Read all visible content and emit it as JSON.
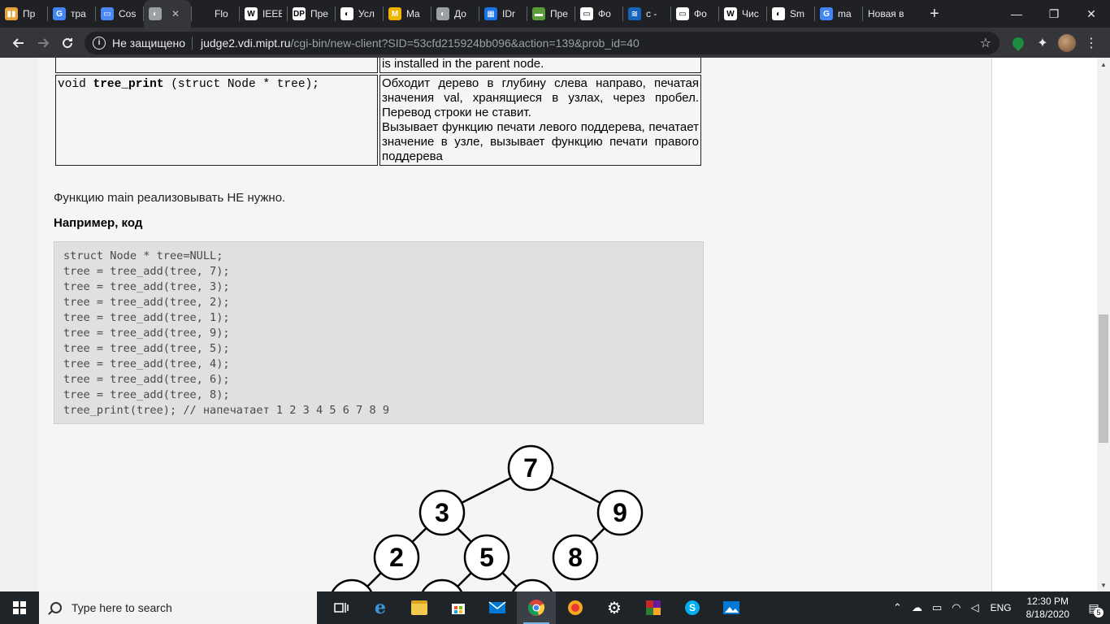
{
  "browser": {
    "tabs": [
      {
        "title": "Пр",
        "favicon_color": "#e8a33d",
        "favicon_text": "▮▮"
      },
      {
        "title": "тра",
        "favicon_color": "#4285f4",
        "favicon_text": "G"
      },
      {
        "title": "Cos",
        "favicon_color": "#4a8af4",
        "favicon_text": "▭"
      },
      {
        "title": "",
        "favicon_color": "#9aa0a6",
        "favicon_text": "◐",
        "active": true
      },
      {
        "title": "Flo",
        "favicon_color": "#202124",
        "favicon_text": ""
      },
      {
        "title": "IEEE",
        "favicon_color": "#ffffff",
        "favicon_text": "W"
      },
      {
        "title": "Пре",
        "favicon_color": "#ffffff",
        "favicon_text": "DP"
      },
      {
        "title": "Усл",
        "favicon_color": "#ffffff",
        "favicon_text": "◐"
      },
      {
        "title": "Ma",
        "favicon_color": "#f0b400",
        "favicon_text": "M"
      },
      {
        "title": "До",
        "favicon_color": "#9aa0a6",
        "favicon_text": "◐"
      },
      {
        "title": "IDr",
        "favicon_color": "#1a73e8",
        "favicon_text": "▦"
      },
      {
        "title": "Пре",
        "favicon_color": "#5a9e3a",
        "favicon_text": "▬"
      },
      {
        "title": "Фо",
        "favicon_color": "#ffffff",
        "favicon_text": "▭"
      },
      {
        "title": "c -",
        "favicon_color": "#1565c0",
        "favicon_text": "≋"
      },
      {
        "title": "Фо",
        "favicon_color": "#ffffff",
        "favicon_text": "▭"
      },
      {
        "title": "Чис",
        "favicon_color": "#ffffff",
        "favicon_text": "W"
      },
      {
        "title": "Sm",
        "favicon_color": "#ffffff",
        "favicon_text": "◐"
      },
      {
        "title": "ma",
        "favicon_color": "#4285f4",
        "favicon_text": "G"
      },
      {
        "title": "Новая в",
        "favicon_color": "",
        "favicon_text": ""
      }
    ],
    "new_tab_label": "+",
    "minimize": "—",
    "maximize": "❐",
    "close": "✕",
    "not_secure": "Не защищено",
    "url_host": "judge2.vdi.mipt.ru",
    "url_path": "/cgi-bin/new-client?SID=53cfd215924bb096&action=139&prob_id=40"
  },
  "content": {
    "table": {
      "row1_desc": "is installed in the parent node.",
      "row2_sig_pre": "void ",
      "row2_sig_fn": "tree_print",
      "row2_sig_post": " (struct Node * tree);",
      "row2_desc_1": "Обходит дерево в глубину слева направо, печатая значения val, хранящиеся в узлах, через пробел. Перевод строки не ставит.",
      "row2_desc_2": "Вызывает функцию печати левого поддерева, печатает значение в узле, вызывает функцию печати правого поддерева"
    },
    "main_note": "Функцию main реализовывать НЕ нужно.",
    "example_heading": "Например, код",
    "code": "struct Node * tree=NULL;\ntree = tree_add(tree, 7);\ntree = tree_add(tree, 3);\ntree = tree_add(tree, 2);\ntree = tree_add(tree, 1);\ntree = tree_add(tree, 9);\ntree = tree_add(tree, 5);\ntree = tree_add(tree, 4);\ntree = tree_add(tree, 6);\ntree = tree_add(tree, 8);\ntree_print(tree); // напечатает 1 2 3 4 5 6 7 8 9",
    "tree_nodes": [
      "7",
      "3",
      "9",
      "2",
      "5",
      "8"
    ]
  },
  "taskbar": {
    "search_placeholder": "Type here to search",
    "lang": "ENG",
    "time": "12:30 PM",
    "date": "8/18/2020",
    "notifications": "5"
  }
}
